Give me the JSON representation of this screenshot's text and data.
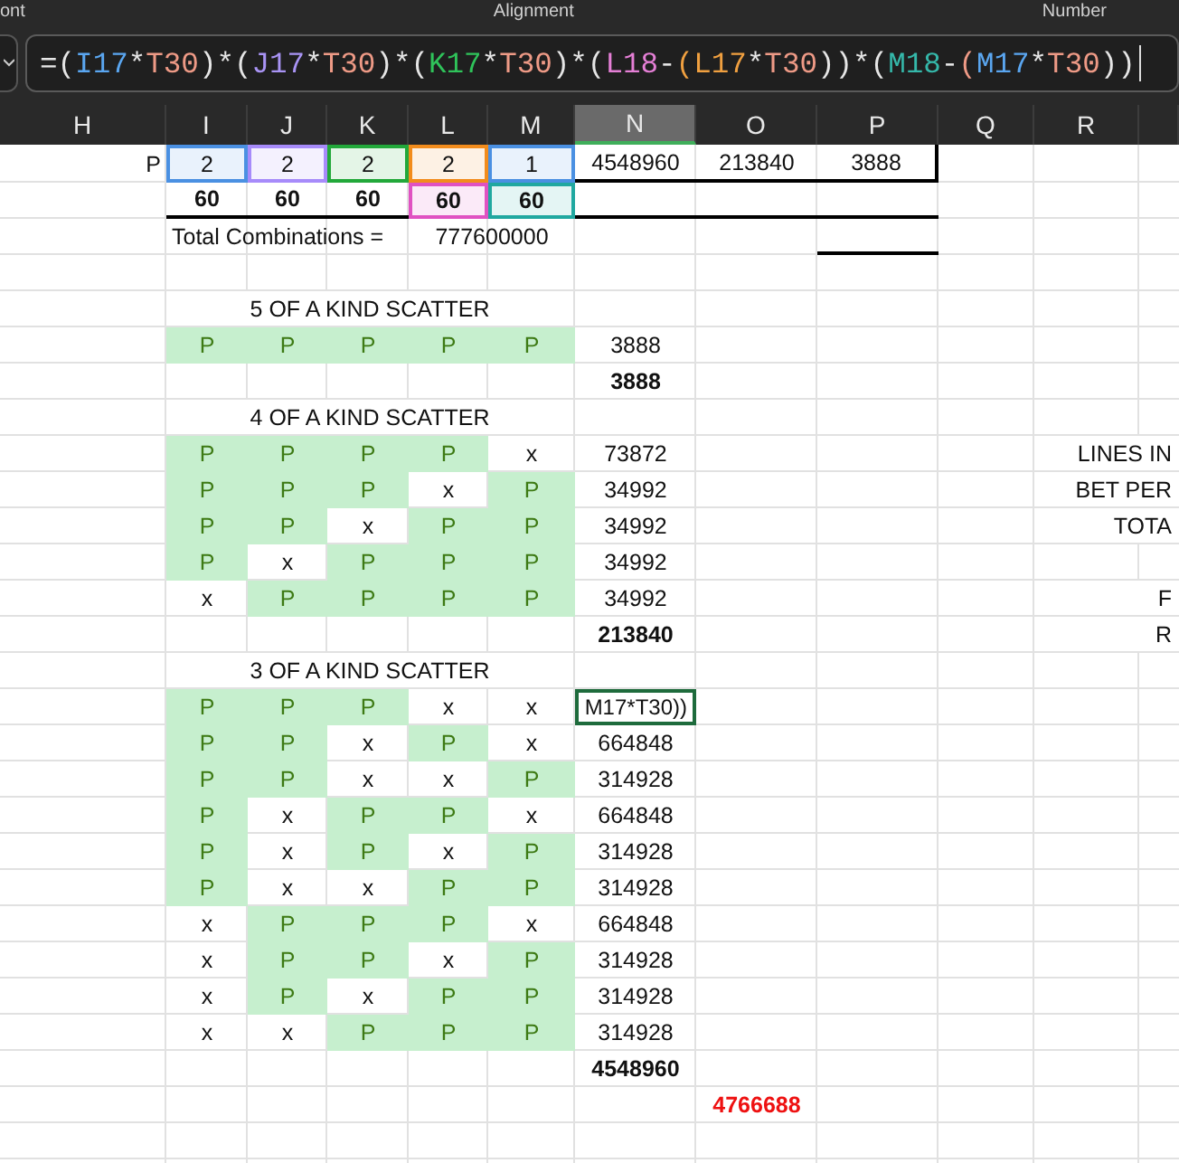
{
  "ribbon": {
    "groups": [
      "ont",
      "Alignment",
      "Number"
    ]
  },
  "formula_bar": {
    "tokens": [
      {
        "text": "=(",
        "color": "#e6e6e6"
      },
      {
        "text": "I17",
        "color": "#5aa6f0"
      },
      {
        "text": "*",
        "color": "#e6e6e6"
      },
      {
        "text": "T30",
        "color": "#ee9a86"
      },
      {
        "text": ")*(",
        "color": "#e6e6e6"
      },
      {
        "text": "J17",
        "color": "#a994f5"
      },
      {
        "text": "*",
        "color": "#e6e6e6"
      },
      {
        "text": "T30",
        "color": "#ee9a86"
      },
      {
        "text": ")*(",
        "color": "#e6e6e6"
      },
      {
        "text": "K17",
        "color": "#2fc35a"
      },
      {
        "text": "*",
        "color": "#e6e6e6"
      },
      {
        "text": "T30",
        "color": "#ee9a86"
      },
      {
        "text": ")*(",
        "color": "#e6e6e6"
      },
      {
        "text": "L18",
        "color": "#e57fd6"
      },
      {
        "text": "-",
        "color": "#e6e6e6"
      },
      {
        "text": "(",
        "color": "#f0a040"
      },
      {
        "text": "L17",
        "color": "#f0a040"
      },
      {
        "text": "*",
        "color": "#e6e6e6"
      },
      {
        "text": "T30",
        "color": "#ee9a86"
      },
      {
        "text": "))*(",
        "color": "#e6e6e6"
      },
      {
        "text": "M18",
        "color": "#35b8aa"
      },
      {
        "text": "-",
        "color": "#e6e6e6"
      },
      {
        "text": "(",
        "color": "#ee9a86"
      },
      {
        "text": "M17",
        "color": "#5aa6f0"
      },
      {
        "text": "*",
        "color": "#e6e6e6"
      },
      {
        "text": "T30",
        "color": "#ee9a86"
      },
      {
        "text": "))",
        "color": "#e6e6e6"
      }
    ]
  },
  "column_headers": [
    {
      "label": "H",
      "selected": false
    },
    {
      "label": "I",
      "selected": false
    },
    {
      "label": "J",
      "selected": false
    },
    {
      "label": "K",
      "selected": false
    },
    {
      "label": "L",
      "selected": false
    },
    {
      "label": "M",
      "selected": false
    },
    {
      "label": "N",
      "selected": true
    },
    {
      "label": "O",
      "selected": false
    },
    {
      "label": "P",
      "selected": false
    },
    {
      "label": "Q",
      "selected": false
    },
    {
      "label": "R",
      "selected": false
    }
  ],
  "reference_row": {
    "label": "P",
    "multipliers": [
      {
        "text": "2",
        "color": "#4a90e2"
      },
      {
        "text": "2",
        "color": "#a78bfa"
      },
      {
        "text": "2",
        "color": "#22a83a"
      },
      {
        "text": "2",
        "color": "#f28c1c"
      },
      {
        "text": "1",
        "color": "#4a90e2"
      }
    ],
    "results": [
      "4548960",
      "213840",
      "3888"
    ]
  },
  "reel_sizes": [
    {
      "text": "60"
    },
    {
      "text": "60"
    },
    {
      "text": "60"
    },
    {
      "text": "60",
      "color": "#e052c2"
    },
    {
      "text": "60",
      "color": "#20a8a0"
    }
  ],
  "total_combinations": {
    "label": "Total Combinations =",
    "value": "777600000"
  },
  "scatter_groups": [
    {
      "title": "5 OF A KIND SCATTER",
      "rows": [
        {
          "symbols": [
            {
              "text": "P",
              "shaded": true
            },
            {
              "text": "P",
              "shaded": true
            },
            {
              "text": "P",
              "shaded": true
            },
            {
              "text": "P",
              "shaded": true
            },
            {
              "text": "P",
              "shaded": true
            }
          ],
          "value": "3888",
          "selected": false
        }
      ],
      "total": "3888"
    },
    {
      "title": "4 OF A KIND SCATTER",
      "rows": [
        {
          "symbols": [
            {
              "text": "P",
              "shaded": true
            },
            {
              "text": "P",
              "shaded": true
            },
            {
              "text": "P",
              "shaded": true
            },
            {
              "text": "P",
              "shaded": true
            },
            {
              "text": "x",
              "shaded": false
            }
          ],
          "value": "73872",
          "selected": false
        },
        {
          "symbols": [
            {
              "text": "P",
              "shaded": true
            },
            {
              "text": "P",
              "shaded": true
            },
            {
              "text": "P",
              "shaded": true
            },
            {
              "text": "x",
              "shaded": false
            },
            {
              "text": "P",
              "shaded": true
            }
          ],
          "value": "34992",
          "selected": false
        },
        {
          "symbols": [
            {
              "text": "P",
              "shaded": true
            },
            {
              "text": "P",
              "shaded": true
            },
            {
              "text": "x",
              "shaded": false
            },
            {
              "text": "P",
              "shaded": true
            },
            {
              "text": "P",
              "shaded": true
            }
          ],
          "value": "34992",
          "selected": false
        },
        {
          "symbols": [
            {
              "text": "P",
              "shaded": true
            },
            {
              "text": "x",
              "shaded": false
            },
            {
              "text": "P",
              "shaded": true
            },
            {
              "text": "P",
              "shaded": true
            },
            {
              "text": "P",
              "shaded": true
            }
          ],
          "value": "34992",
          "selected": false
        },
        {
          "symbols": [
            {
              "text": "x",
              "shaded": false
            },
            {
              "text": "P",
              "shaded": true
            },
            {
              "text": "P",
              "shaded": true
            },
            {
              "text": "P",
              "shaded": true
            },
            {
              "text": "P",
              "shaded": true
            }
          ],
          "value": "34992",
          "selected": false
        }
      ],
      "total": "213840"
    },
    {
      "title": "3 OF A KIND SCATTER",
      "rows": [
        {
          "symbols": [
            {
              "text": "P",
              "shaded": true
            },
            {
              "text": "P",
              "shaded": true
            },
            {
              "text": "P",
              "shaded": true
            },
            {
              "text": "x",
              "shaded": false
            },
            {
              "text": "x",
              "shaded": false
            }
          ],
          "value": "M17*T30))",
          "selected": true
        },
        {
          "symbols": [
            {
              "text": "P",
              "shaded": true
            },
            {
              "text": "P",
              "shaded": true
            },
            {
              "text": "x",
              "shaded": false
            },
            {
              "text": "P",
              "shaded": true
            },
            {
              "text": "x",
              "shaded": false
            }
          ],
          "value": "664848",
          "selected": false
        },
        {
          "symbols": [
            {
              "text": "P",
              "shaded": true
            },
            {
              "text": "P",
              "shaded": true
            },
            {
              "text": "x",
              "shaded": false
            },
            {
              "text": "x",
              "shaded": false
            },
            {
              "text": "P",
              "shaded": true
            }
          ],
          "value": "314928",
          "selected": false
        },
        {
          "symbols": [
            {
              "text": "P",
              "shaded": true
            },
            {
              "text": "x",
              "shaded": false
            },
            {
              "text": "P",
              "shaded": true
            },
            {
              "text": "P",
              "shaded": true
            },
            {
              "text": "x",
              "shaded": false
            }
          ],
          "value": "664848",
          "selected": false
        },
        {
          "symbols": [
            {
              "text": "P",
              "shaded": true
            },
            {
              "text": "x",
              "shaded": false
            },
            {
              "text": "P",
              "shaded": true
            },
            {
              "text": "x",
              "shaded": false
            },
            {
              "text": "P",
              "shaded": true
            }
          ],
          "value": "314928",
          "selected": false
        },
        {
          "symbols": [
            {
              "text": "P",
              "shaded": true
            },
            {
              "text": "x",
              "shaded": false
            },
            {
              "text": "x",
              "shaded": false
            },
            {
              "text": "P",
              "shaded": true
            },
            {
              "text": "P",
              "shaded": true
            }
          ],
          "value": "314928",
          "selected": false
        },
        {
          "symbols": [
            {
              "text": "x",
              "shaded": false
            },
            {
              "text": "P",
              "shaded": true
            },
            {
              "text": "P",
              "shaded": true
            },
            {
              "text": "P",
              "shaded": true
            },
            {
              "text": "x",
              "shaded": false
            }
          ],
          "value": "664848",
          "selected": false
        },
        {
          "symbols": [
            {
              "text": "x",
              "shaded": false
            },
            {
              "text": "P",
              "shaded": true
            },
            {
              "text": "P",
              "shaded": true
            },
            {
              "text": "x",
              "shaded": false
            },
            {
              "text": "P",
              "shaded": true
            }
          ],
          "value": "314928",
          "selected": false
        },
        {
          "symbols": [
            {
              "text": "x",
              "shaded": false
            },
            {
              "text": "P",
              "shaded": true
            },
            {
              "text": "x",
              "shaded": false
            },
            {
              "text": "P",
              "shaded": true
            },
            {
              "text": "P",
              "shaded": true
            }
          ],
          "value": "314928",
          "selected": false
        },
        {
          "symbols": [
            {
              "text": "x",
              "shaded": false
            },
            {
              "text": "x",
              "shaded": false
            },
            {
              "text": "P",
              "shaded": true
            },
            {
              "text": "P",
              "shaded": true
            },
            {
              "text": "P",
              "shaded": true
            }
          ],
          "value": "314928",
          "selected": false
        }
      ],
      "total": "4548960"
    }
  ],
  "grand_total": "4766688",
  "side_labels": [
    "LINES IN",
    "BET PER",
    "TOTA",
    "F",
    "R"
  ]
}
